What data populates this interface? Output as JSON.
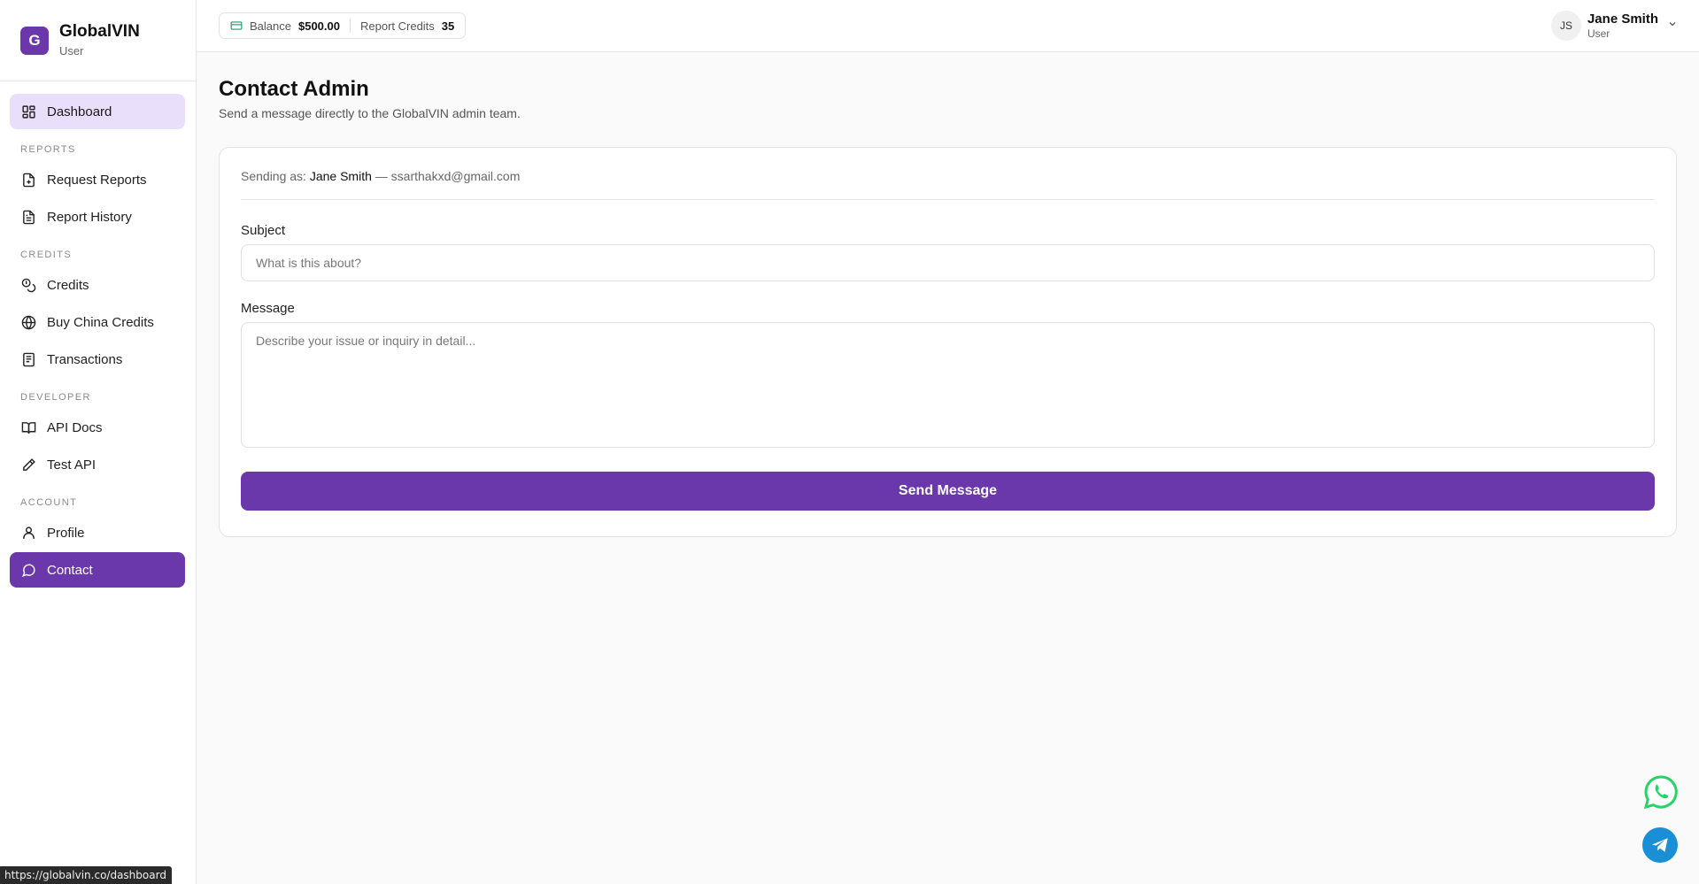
{
  "brand": {
    "logo_letter": "G",
    "name": "GlobalVIN",
    "role": "User"
  },
  "sidebar": {
    "dashboard": {
      "label": "Dashboard",
      "icon": "grid-icon"
    },
    "sections": [
      {
        "title": "REPORTS",
        "items": [
          {
            "label": "Request Reports",
            "icon": "file-plus-icon"
          },
          {
            "label": "Report History",
            "icon": "file-text-icon"
          }
        ]
      },
      {
        "title": "CREDITS",
        "items": [
          {
            "label": "Credits",
            "icon": "coins-icon"
          },
          {
            "label": "Buy China Credits",
            "icon": "globe-icon"
          },
          {
            "label": "Transactions",
            "icon": "receipt-icon"
          }
        ]
      },
      {
        "title": "DEVELOPER",
        "items": [
          {
            "label": "API Docs",
            "icon": "book-icon"
          },
          {
            "label": "Test API",
            "icon": "pencil-icon"
          }
        ]
      },
      {
        "title": "ACCOUNT",
        "items": [
          {
            "label": "Profile",
            "icon": "user-icon"
          },
          {
            "label": "Contact",
            "icon": "chat-icon"
          }
        ]
      }
    ]
  },
  "topbar": {
    "balance_label": "Balance",
    "balance_value": "$500.00",
    "credits_label": "Report Credits",
    "credits_value": "35",
    "user_initials": "JS",
    "user_name": "Jane Smith",
    "user_role": "User"
  },
  "main": {
    "title": "Contact Admin",
    "subtitle": "Send a message directly to the GlobalVIN admin team.",
    "sending_prefix": "Sending as:",
    "sending_name": "Jane Smith",
    "sending_email": "— ssarthakxd@gmail.com",
    "subject_label": "Subject",
    "subject_placeholder": "What is this about?",
    "subject_value": "",
    "message_label": "Message",
    "message_placeholder": "Describe your issue or inquiry in detail...",
    "message_value": "",
    "send_label": "Send Message"
  },
  "status_bar": {
    "url": "https://globalvin.co/dashboard"
  },
  "colors": {
    "accent": "#6b38ab",
    "accent_soft": "#eadffa",
    "whatsapp": "#25d366",
    "telegram": "#1b8fd6"
  }
}
